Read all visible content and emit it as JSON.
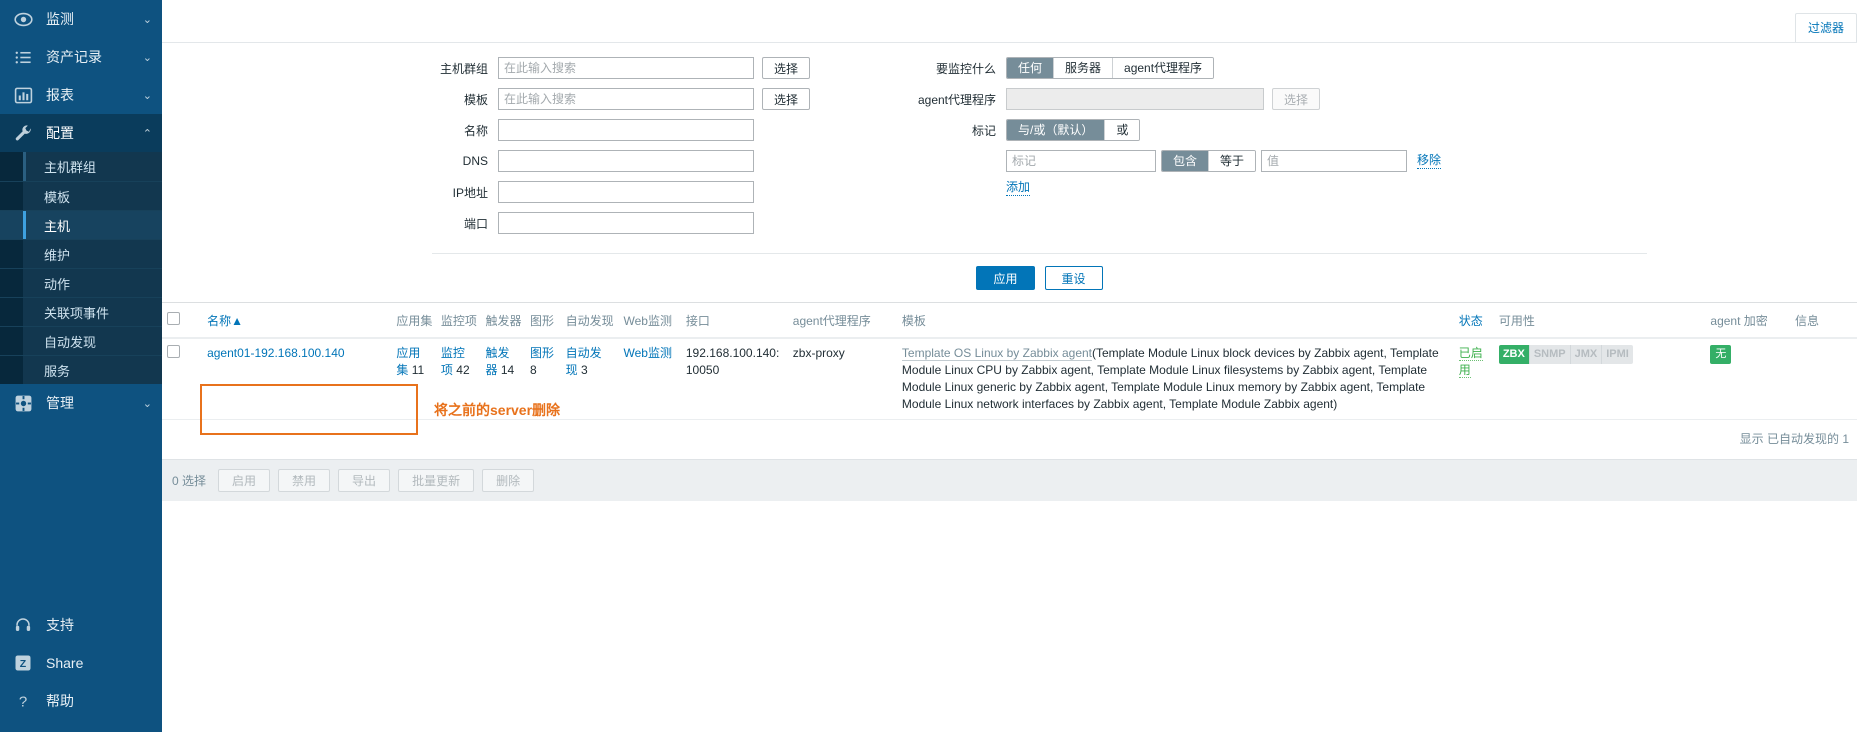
{
  "sidebar": {
    "top_items": [
      {
        "label": "监测",
        "icon": "eye-icon",
        "chevron": "⌄",
        "expanded": false
      },
      {
        "label": "资产记录",
        "icon": "list-icon",
        "chevron": "⌄",
        "expanded": false
      },
      {
        "label": "报表",
        "icon": "chart-bar-icon",
        "chevron": "⌄",
        "expanded": false
      },
      {
        "label": "配置",
        "icon": "wrench-icon",
        "chevron": "⌃",
        "expanded": true
      }
    ],
    "submenu": [
      {
        "label": "主机群组",
        "state": "highlight"
      },
      {
        "label": "模板",
        "state": "normal"
      },
      {
        "label": "主机",
        "state": "active"
      },
      {
        "label": "维护",
        "state": "normal"
      },
      {
        "label": "动作",
        "state": "normal"
      },
      {
        "label": "关联项事件",
        "state": "normal"
      },
      {
        "label": "自动发现",
        "state": "normal"
      },
      {
        "label": "服务",
        "state": "normal"
      }
    ],
    "admin_item": {
      "label": "管理",
      "icon": "gear-icon",
      "chevron": "⌄"
    },
    "bottom_items": [
      {
        "label": "支持",
        "icon": "headset-icon"
      },
      {
        "label": "Share",
        "icon": "zabbix-z-icon"
      },
      {
        "label": "帮助",
        "icon": "question-icon"
      }
    ]
  },
  "filter_tab": {
    "label": "过滤器"
  },
  "filter": {
    "left": {
      "host_group": {
        "label": "主机群组",
        "value": "",
        "placeholder": "在此输入搜索",
        "select_button": "选择"
      },
      "template": {
        "label": "模板",
        "value": "",
        "placeholder": "在此输入搜索",
        "select_button": "选择"
      },
      "name": {
        "label": "名称",
        "value": "",
        "placeholder": ""
      },
      "dns": {
        "label": "DNS",
        "value": "",
        "placeholder": ""
      },
      "ip_address": {
        "label": "IP地址",
        "value": "",
        "placeholder": ""
      },
      "port": {
        "label": "端口",
        "value": "",
        "placeholder": ""
      }
    },
    "right": {
      "monitored_by": {
        "label": "要监控什么",
        "options": [
          "任何",
          "服务器",
          "agent代理程序"
        ],
        "selected": "任何"
      },
      "proxy": {
        "label": "agent代理程序",
        "value": "",
        "placeholder": "",
        "select_button": "选择",
        "disabled": true
      },
      "tags": {
        "label": "标记",
        "evaltype_options": [
          "与/或（默认）",
          "或"
        ],
        "evaltype_selected": "与/或（默认）",
        "rows": [
          {
            "tag_value": "",
            "tag_placeholder": "标记",
            "operator_options": [
              "包含",
              "等于"
            ],
            "operator_selected": "包含",
            "value_value": "",
            "value_placeholder": "值",
            "remove_label": "移除"
          }
        ],
        "add_label": "添加"
      }
    },
    "apply_button": "应用",
    "reset_button": "重设"
  },
  "table": {
    "headers": {
      "checkbox": "",
      "name": "名称",
      "sort_arrow": "▲",
      "applications": "应用集",
      "items": "监控项",
      "triggers": "触发器",
      "graphs": "图形",
      "discovery": "自动发现",
      "web": "Web监测",
      "interface": "接口",
      "proxy": "agent代理程序",
      "templates": "模板",
      "status": "状态",
      "availability": "可用性",
      "agent_encryption": "agent 加密",
      "info": "信息"
    },
    "rows": [
      {
        "name": "agent01-192.168.100.140",
        "applications_label": "应用集",
        "applications_count": "11",
        "items_label": "监控项",
        "items_count": "42",
        "triggers_label": "触发器",
        "triggers_count": "14",
        "graphs_label": "图形",
        "graphs_count": "8",
        "discovery_label": "自动发现",
        "discovery_count": "3",
        "web_label": "Web监测",
        "interface": "192.168.100.140: 10050",
        "proxy": "zbx-proxy",
        "templates_prefix": "Template OS Linux by Zabbix agent",
        "templates_nested": "(Template Module Linux block devices by Zabbix agent, Template Module Linux CPU by Zabbix agent, Template Module Linux filesystems by Zabbix agent, Template Module Linux generic by Zabbix agent, Template Module Linux memory by Zabbix agent, Template Module Linux network interfaces by Zabbix agent, Template Module Zabbix agent)",
        "templates_list": [
          "Template OS Linux by Zabbix agent",
          "Template Module Linux block devices by Zabbix agent",
          "Template Module Linux CPU by Zabbix agent",
          "Template Module Linux filesystems by Zabbix agent",
          "Template Module Linux generic by Zabbix agent",
          "Template Module Linux memory by Zabbix agent",
          "Template Module Linux network interfaces by Zabbix agent",
          "Template Module Zabbix agent"
        ],
        "status": "已启用",
        "availability": [
          {
            "label": "ZBX",
            "state": "on"
          },
          {
            "label": "SNMP",
            "state": "off"
          },
          {
            "label": "JMX",
            "state": "off"
          },
          {
            "label": "IPMI",
            "state": "off"
          }
        ],
        "encryption": "无"
      }
    ],
    "showing_text": "显示 已自动发现的 1"
  },
  "footer": {
    "selected_text": "0 选择",
    "buttons": [
      "启用",
      "禁用",
      "导出",
      "批量更新",
      "删除"
    ]
  },
  "annotation": {
    "text": "将之前的server删除",
    "color": "#e8721c"
  },
  "colors": {
    "sidebar_bg": "#0e5280",
    "sidebar_expanded": "#0a3c5c",
    "submenu_bg": "#12374f",
    "accent_link": "#0275b8",
    "muted": "#768d99",
    "green": "#34af67",
    "annotation": "#e8721c"
  }
}
